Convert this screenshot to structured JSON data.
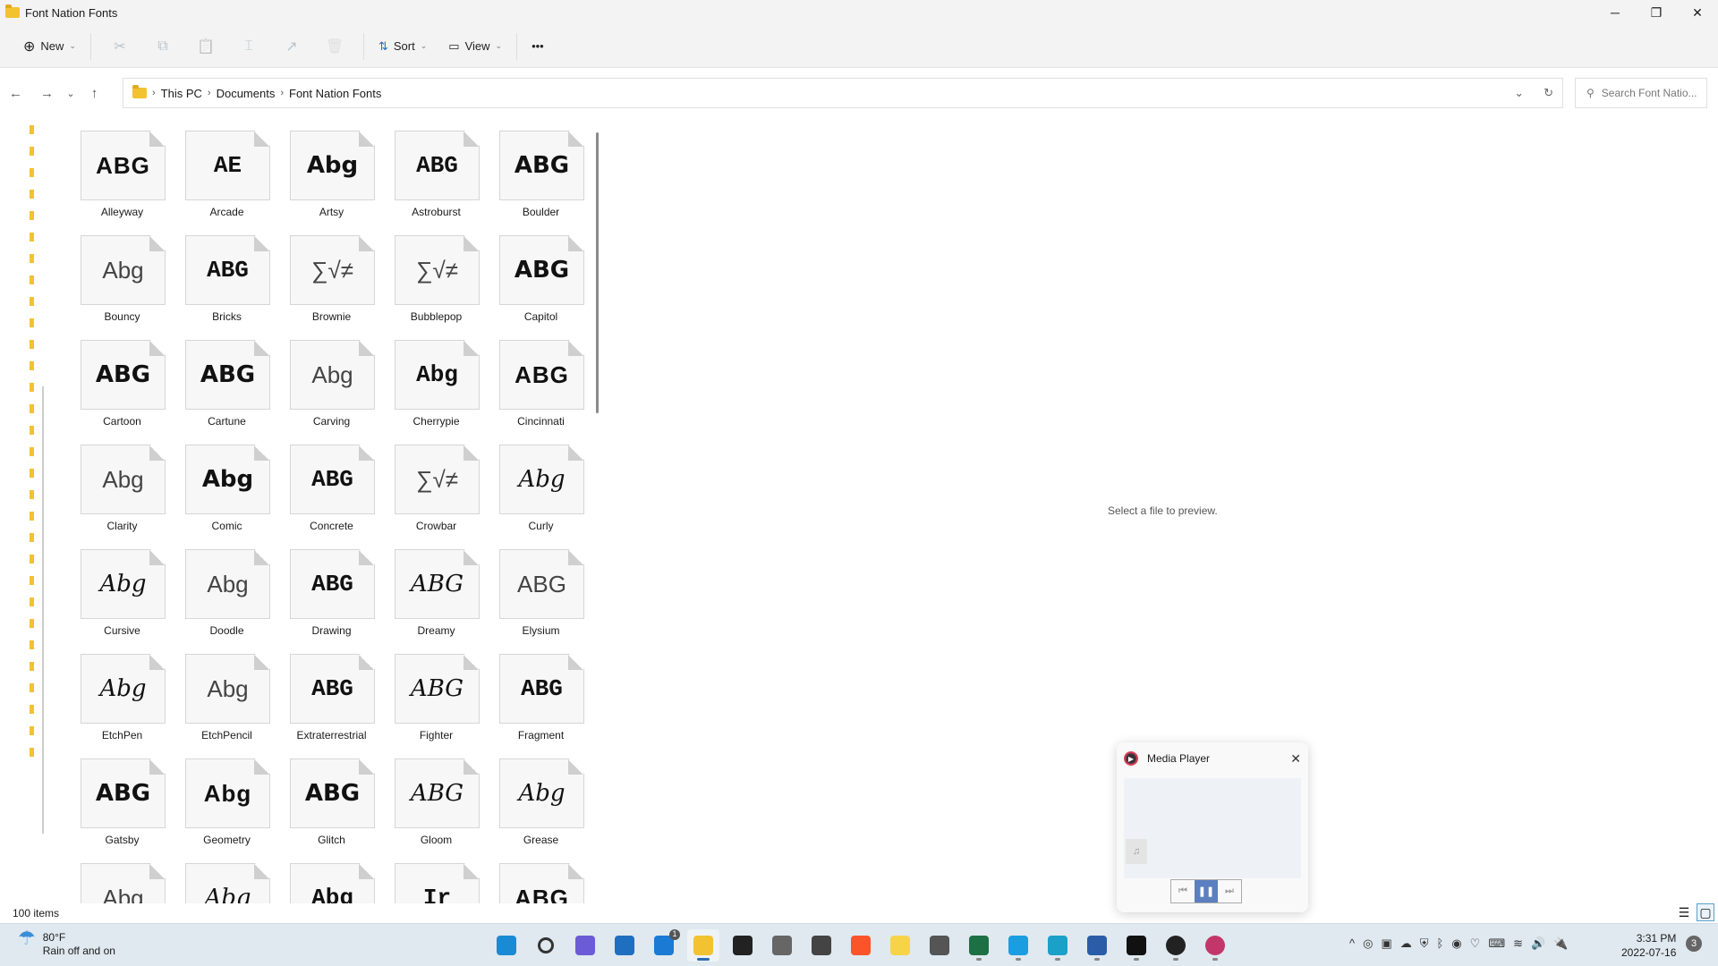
{
  "window": {
    "title": "Font Nation Fonts",
    "minimize": "─",
    "maximize": "❐",
    "close": "✕"
  },
  "toolbar": {
    "new": "New",
    "sort": "Sort",
    "view": "View",
    "more": "•••",
    "cut": "✂",
    "copy": "⧉",
    "paste": "📋",
    "rename": "⌶",
    "share": "↗",
    "delete": "🗑"
  },
  "nav": {
    "back": "←",
    "forward": "→",
    "recent": "⌄",
    "up": "↑"
  },
  "breadcrumb": [
    "This PC",
    "Documents",
    "Font Nation Fonts"
  ],
  "search": {
    "placeholder": "Search Font Natio..."
  },
  "files": [
    {
      "name": "Alleyway",
      "sample": "ABG",
      "style": 0
    },
    {
      "name": "Arcade",
      "sample": "AE",
      "style": 3
    },
    {
      "name": "Artsy",
      "sample": "Abg",
      "style": 1
    },
    {
      "name": "Astroburst",
      "sample": "ABG",
      "style": 3
    },
    {
      "name": "Boulder",
      "sample": "ABG",
      "style": 1
    },
    {
      "name": "Bouncy",
      "sample": "Abg",
      "style": 4
    },
    {
      "name": "Bricks",
      "sample": "ABG",
      "style": 3
    },
    {
      "name": "Brownie",
      "sample": "∑√≠",
      "style": 4
    },
    {
      "name": "Bubblepop",
      "sample": "∑√≠",
      "style": 4
    },
    {
      "name": "Capitol",
      "sample": "ABG",
      "style": 1
    },
    {
      "name": "Cartoon",
      "sample": "ABG",
      "style": 1
    },
    {
      "name": "Cartune",
      "sample": "ABG",
      "style": 1
    },
    {
      "name": "Carving",
      "sample": "Abg",
      "style": 4
    },
    {
      "name": "Cherrypie",
      "sample": "Abg",
      "style": 3
    },
    {
      "name": "Cincinnati",
      "sample": "ABG",
      "style": 0
    },
    {
      "name": "Clarity",
      "sample": "Abg",
      "style": 4
    },
    {
      "name": "Comic",
      "sample": "Abg",
      "style": 1
    },
    {
      "name": "Concrete",
      "sample": "ABG",
      "style": 3
    },
    {
      "name": "Crowbar",
      "sample": "∑√≠",
      "style": 4
    },
    {
      "name": "Curly",
      "sample": "Abg",
      "style": 2
    },
    {
      "name": "Cursive",
      "sample": "Abg",
      "style": 2
    },
    {
      "name": "Doodle",
      "sample": "Abg",
      "style": 4
    },
    {
      "name": "Drawing",
      "sample": "ABG",
      "style": 3
    },
    {
      "name": "Dreamy",
      "sample": "ABG",
      "style": 2
    },
    {
      "name": "Elysium",
      "sample": "ABG",
      "style": 4
    },
    {
      "name": "EtchPen",
      "sample": "Abg",
      "style": 2
    },
    {
      "name": "EtchPencil",
      "sample": "Abg",
      "style": 4
    },
    {
      "name": "Extraterrestrial",
      "sample": "ABG",
      "style": 3
    },
    {
      "name": "Fighter",
      "sample": "ABG",
      "style": 2
    },
    {
      "name": "Fragment",
      "sample": "ABG",
      "style": 3
    },
    {
      "name": "Gatsby",
      "sample": "ABG",
      "style": 1
    },
    {
      "name": "Geometry",
      "sample": "Abg",
      "style": 0
    },
    {
      "name": "Glitch",
      "sample": "ABG",
      "style": 1
    },
    {
      "name": "Gloom",
      "sample": "ABG",
      "style": 2
    },
    {
      "name": "Grease",
      "sample": "Abg",
      "style": 2
    },
    {
      "name": "",
      "sample": "Abg",
      "style": 4
    },
    {
      "name": "",
      "sample": "Abg",
      "style": 2
    },
    {
      "name": "",
      "sample": "Abg",
      "style": 3
    },
    {
      "name": "",
      "sample": "Ir",
      "style": 3
    },
    {
      "name": "",
      "sample": "ABG",
      "style": 0
    }
  ],
  "preview": {
    "message": "Select a file to preview."
  },
  "status": {
    "count": "100 items"
  },
  "media_player": {
    "title": "Media Player",
    "close": "✕",
    "prev": "⏮",
    "pause": "❚❚",
    "next": "⏭",
    "note": "♫"
  },
  "taskbar": {
    "weather": {
      "temp": "80°F",
      "condition": "Rain off and on"
    },
    "apps": [
      {
        "name": "start",
        "color": "#1a8ad4"
      },
      {
        "name": "search",
        "color": "#333333"
      },
      {
        "name": "teams-chat",
        "color": "#6b5bd6"
      },
      {
        "name": "store",
        "color": "#1f6fc0"
      },
      {
        "name": "mail",
        "color": "#1a7ad4",
        "badge": "1"
      },
      {
        "name": "file-explorer",
        "color": "#f2c230",
        "active": true
      },
      {
        "name": "epic-games",
        "color": "#222222"
      },
      {
        "name": "brave-like",
        "color": "#666666"
      },
      {
        "name": "unity-alt",
        "color": "#444444"
      },
      {
        "name": "brave",
        "color": "#fb542b"
      },
      {
        "name": "sticky",
        "color": "#f5d547"
      },
      {
        "name": "calculator",
        "color": "#555555"
      },
      {
        "name": "excel",
        "color": "#1d7044"
      },
      {
        "name": "edge",
        "color": "#1b9de2"
      },
      {
        "name": "edge-dev",
        "color": "#1ba0c8"
      },
      {
        "name": "word",
        "color": "#2b5ca8"
      },
      {
        "name": "unity",
        "color": "#111111"
      },
      {
        "name": "obs",
        "color": "#222222"
      },
      {
        "name": "media-player",
        "color": "#c3366a"
      }
    ],
    "tray": [
      "^",
      "◎",
      "▣",
      "☁",
      "⛨",
      "ᛒ",
      "◉",
      "♡",
      "⌨",
      "≋",
      "🔊",
      "🔌"
    ],
    "time": "3:31 PM",
    "date": "2022-07-16",
    "notifications": "3"
  }
}
